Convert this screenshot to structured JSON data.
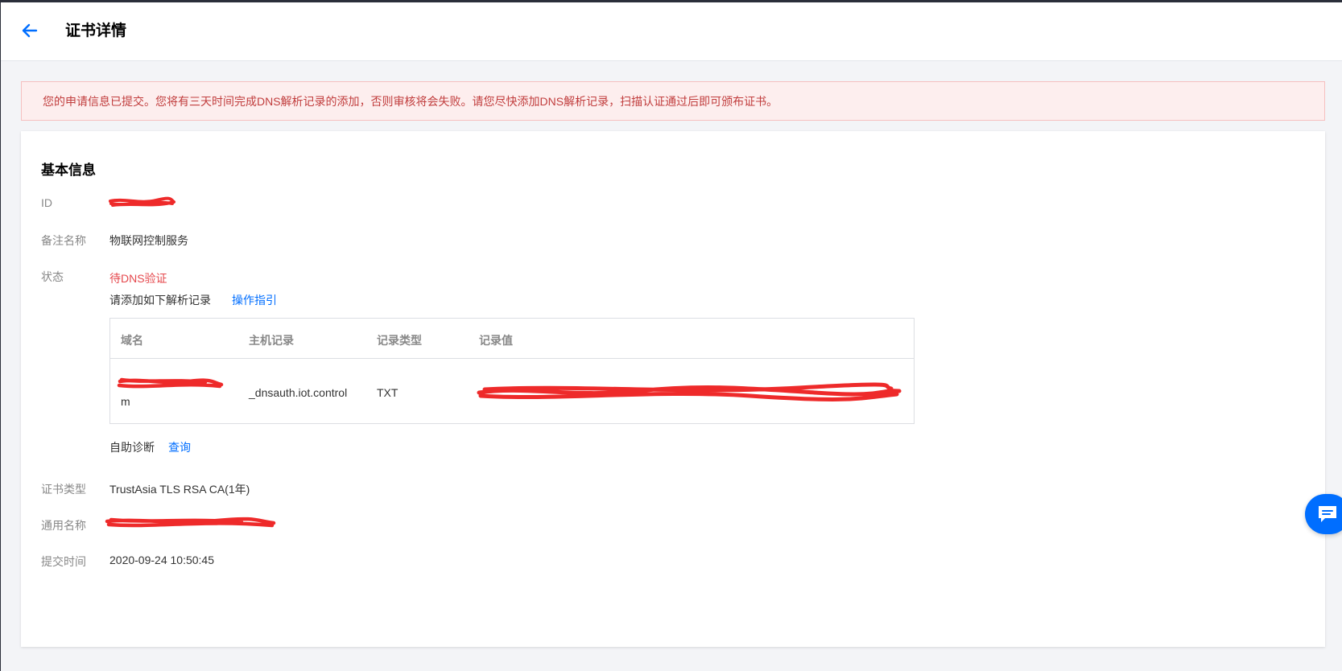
{
  "header": {
    "title": "证书详情"
  },
  "alert": {
    "message": "您的申请信息已提交。您将有三天时间完成DNS解析记录的添加，否则审核将会失败。请您尽快添加DNS解析记录，扫描认证通过后即可颁布证书。"
  },
  "basic": {
    "section_title": "基本信息",
    "id_label": "ID",
    "remark_label": "备注名称",
    "remark_value": "物联网控制服务",
    "status_label": "状态",
    "status_value": "待DNS验证",
    "add_record_text": "请添加如下解析记录",
    "guide_link": "操作指引",
    "diagnose_text": "自助诊断",
    "query_link": "查询",
    "cert_type_label": "证书类型",
    "cert_type_value": "TrustAsia TLS RSA CA(1年)",
    "common_name_label": "通用名称",
    "submit_time_label": "提交时间",
    "submit_time_value": "2020-09-24 10:50:45"
  },
  "dns_table": {
    "headers": [
      "域名",
      "主机记录",
      "记录类型",
      "记录值"
    ],
    "row": {
      "domain_tail": "m",
      "host": "_dnsauth.iot.control",
      "type": "TXT"
    }
  },
  "colors": {
    "accent": "#006eff",
    "status": "#e5484d",
    "redaction": "#ee2a2a"
  },
  "icons": {
    "back": "arrow-left-icon",
    "chat": "chat-icon"
  }
}
